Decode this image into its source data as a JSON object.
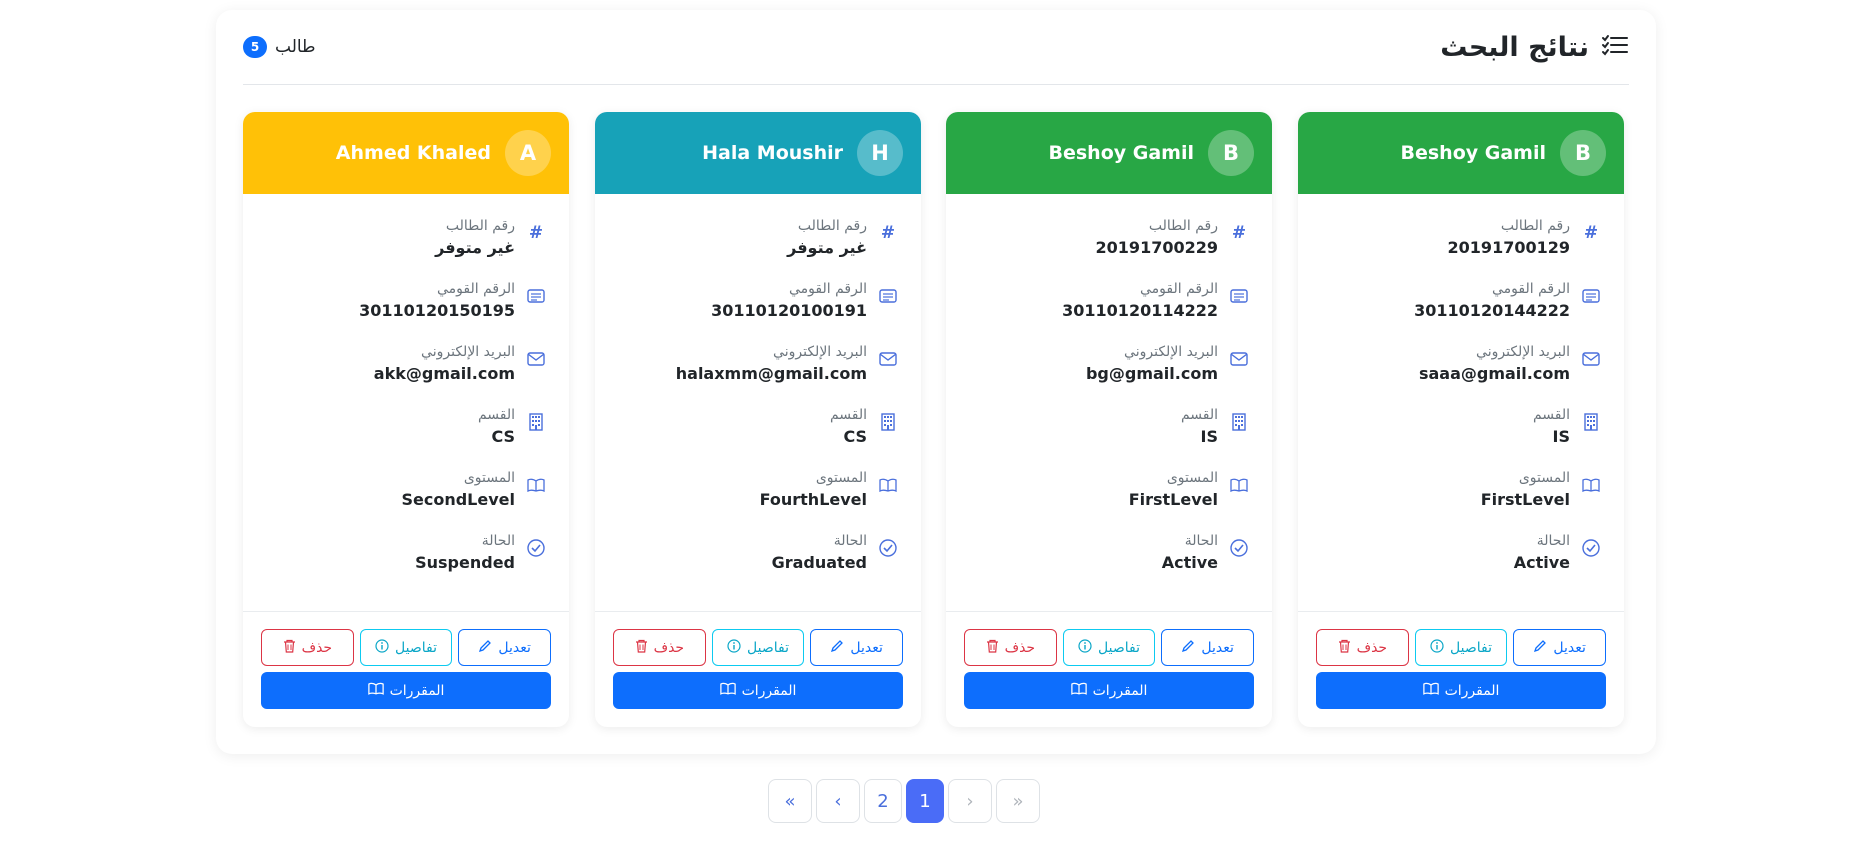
{
  "header": {
    "title": "نتائج البحث",
    "count": "5",
    "count_label": "طالب"
  },
  "labels": {
    "student_id": "رقم الطالب",
    "national_id": "الرقم القومي",
    "email": "البريد الإلكتروني",
    "department": "القسم",
    "level": "المستوى",
    "status": "الحالة",
    "edit": "تعديل",
    "details": "تفاصيل",
    "delete": "حذف",
    "courses": "المقررات"
  },
  "cards": [
    {
      "initial": "A",
      "name": "Ahmed Khaled",
      "color": "#ffc107",
      "student_id": "غير متوفر",
      "national_id": "30110120150195",
      "email": "akk@gmail.com",
      "department": "CS",
      "level": "SecondLevel",
      "status": "Suspended"
    },
    {
      "initial": "H",
      "name": "Hala Moushir",
      "color": "#17a2b8",
      "student_id": "غير متوفر",
      "national_id": "30110120100191",
      "email": "halaxmm@gmail.com",
      "department": "CS",
      "level": "FourthLevel",
      "status": "Graduated"
    },
    {
      "initial": "B",
      "name": "Beshoy Gamil",
      "color": "#28a745",
      "student_id": "20191700229",
      "national_id": "30110120114222",
      "email": "bg@gmail.com",
      "department": "IS",
      "level": "FirstLevel",
      "status": "Active"
    },
    {
      "initial": "B",
      "name": "Beshoy Gamil",
      "color": "#28a745",
      "student_id": "20191700129",
      "national_id": "30110120144222",
      "email": "saaa@gmail.com",
      "department": "IS",
      "level": "FirstLevel",
      "status": "Active"
    }
  ],
  "pagination": {
    "first": "«",
    "prev": "‹",
    "pages": [
      "2",
      "1"
    ],
    "next": "›",
    "last": "»",
    "active_page": "1"
  }
}
